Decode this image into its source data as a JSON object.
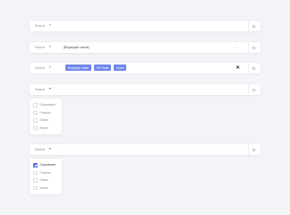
{
  "bars": [
    {
      "search_label": "Search",
      "caret": "▾"
    },
    {
      "search_label": "Search",
      "caret": "▾",
      "typed_text": "|Employee name|",
      "clear": "×"
    },
    {
      "search_label": "Search",
      "caret": "▾",
      "tags": [
        "Employee name",
        "HR Team",
        "Intern"
      ],
      "clear": "✕"
    },
    {
      "search_label": "Search",
      "caret": "▾"
    },
    {
      "search_label": "Search",
      "caret": "▾"
    }
  ],
  "menu_a": {
    "items": [
      {
        "label": "Department",
        "checked": false
      },
      {
        "label": "Position",
        "checked": false
      },
      {
        "label": "Status",
        "checked": false
      },
      {
        "label": "Name",
        "checked": false
      }
    ]
  },
  "menu_b": {
    "items": [
      {
        "label": "Department",
        "checked": true
      },
      {
        "label": "Position",
        "checked": false
      },
      {
        "label": "Status",
        "checked": false
      },
      {
        "label": "Name",
        "checked": false
      }
    ]
  },
  "colors": {
    "accent": "#4d6fe3",
    "tag": "#6f86ea",
    "background": "#f3f4f7"
  },
  "icons": {
    "settings": "gear-icon",
    "clear": "close-icon",
    "dropdown": "chevron-down-icon"
  }
}
